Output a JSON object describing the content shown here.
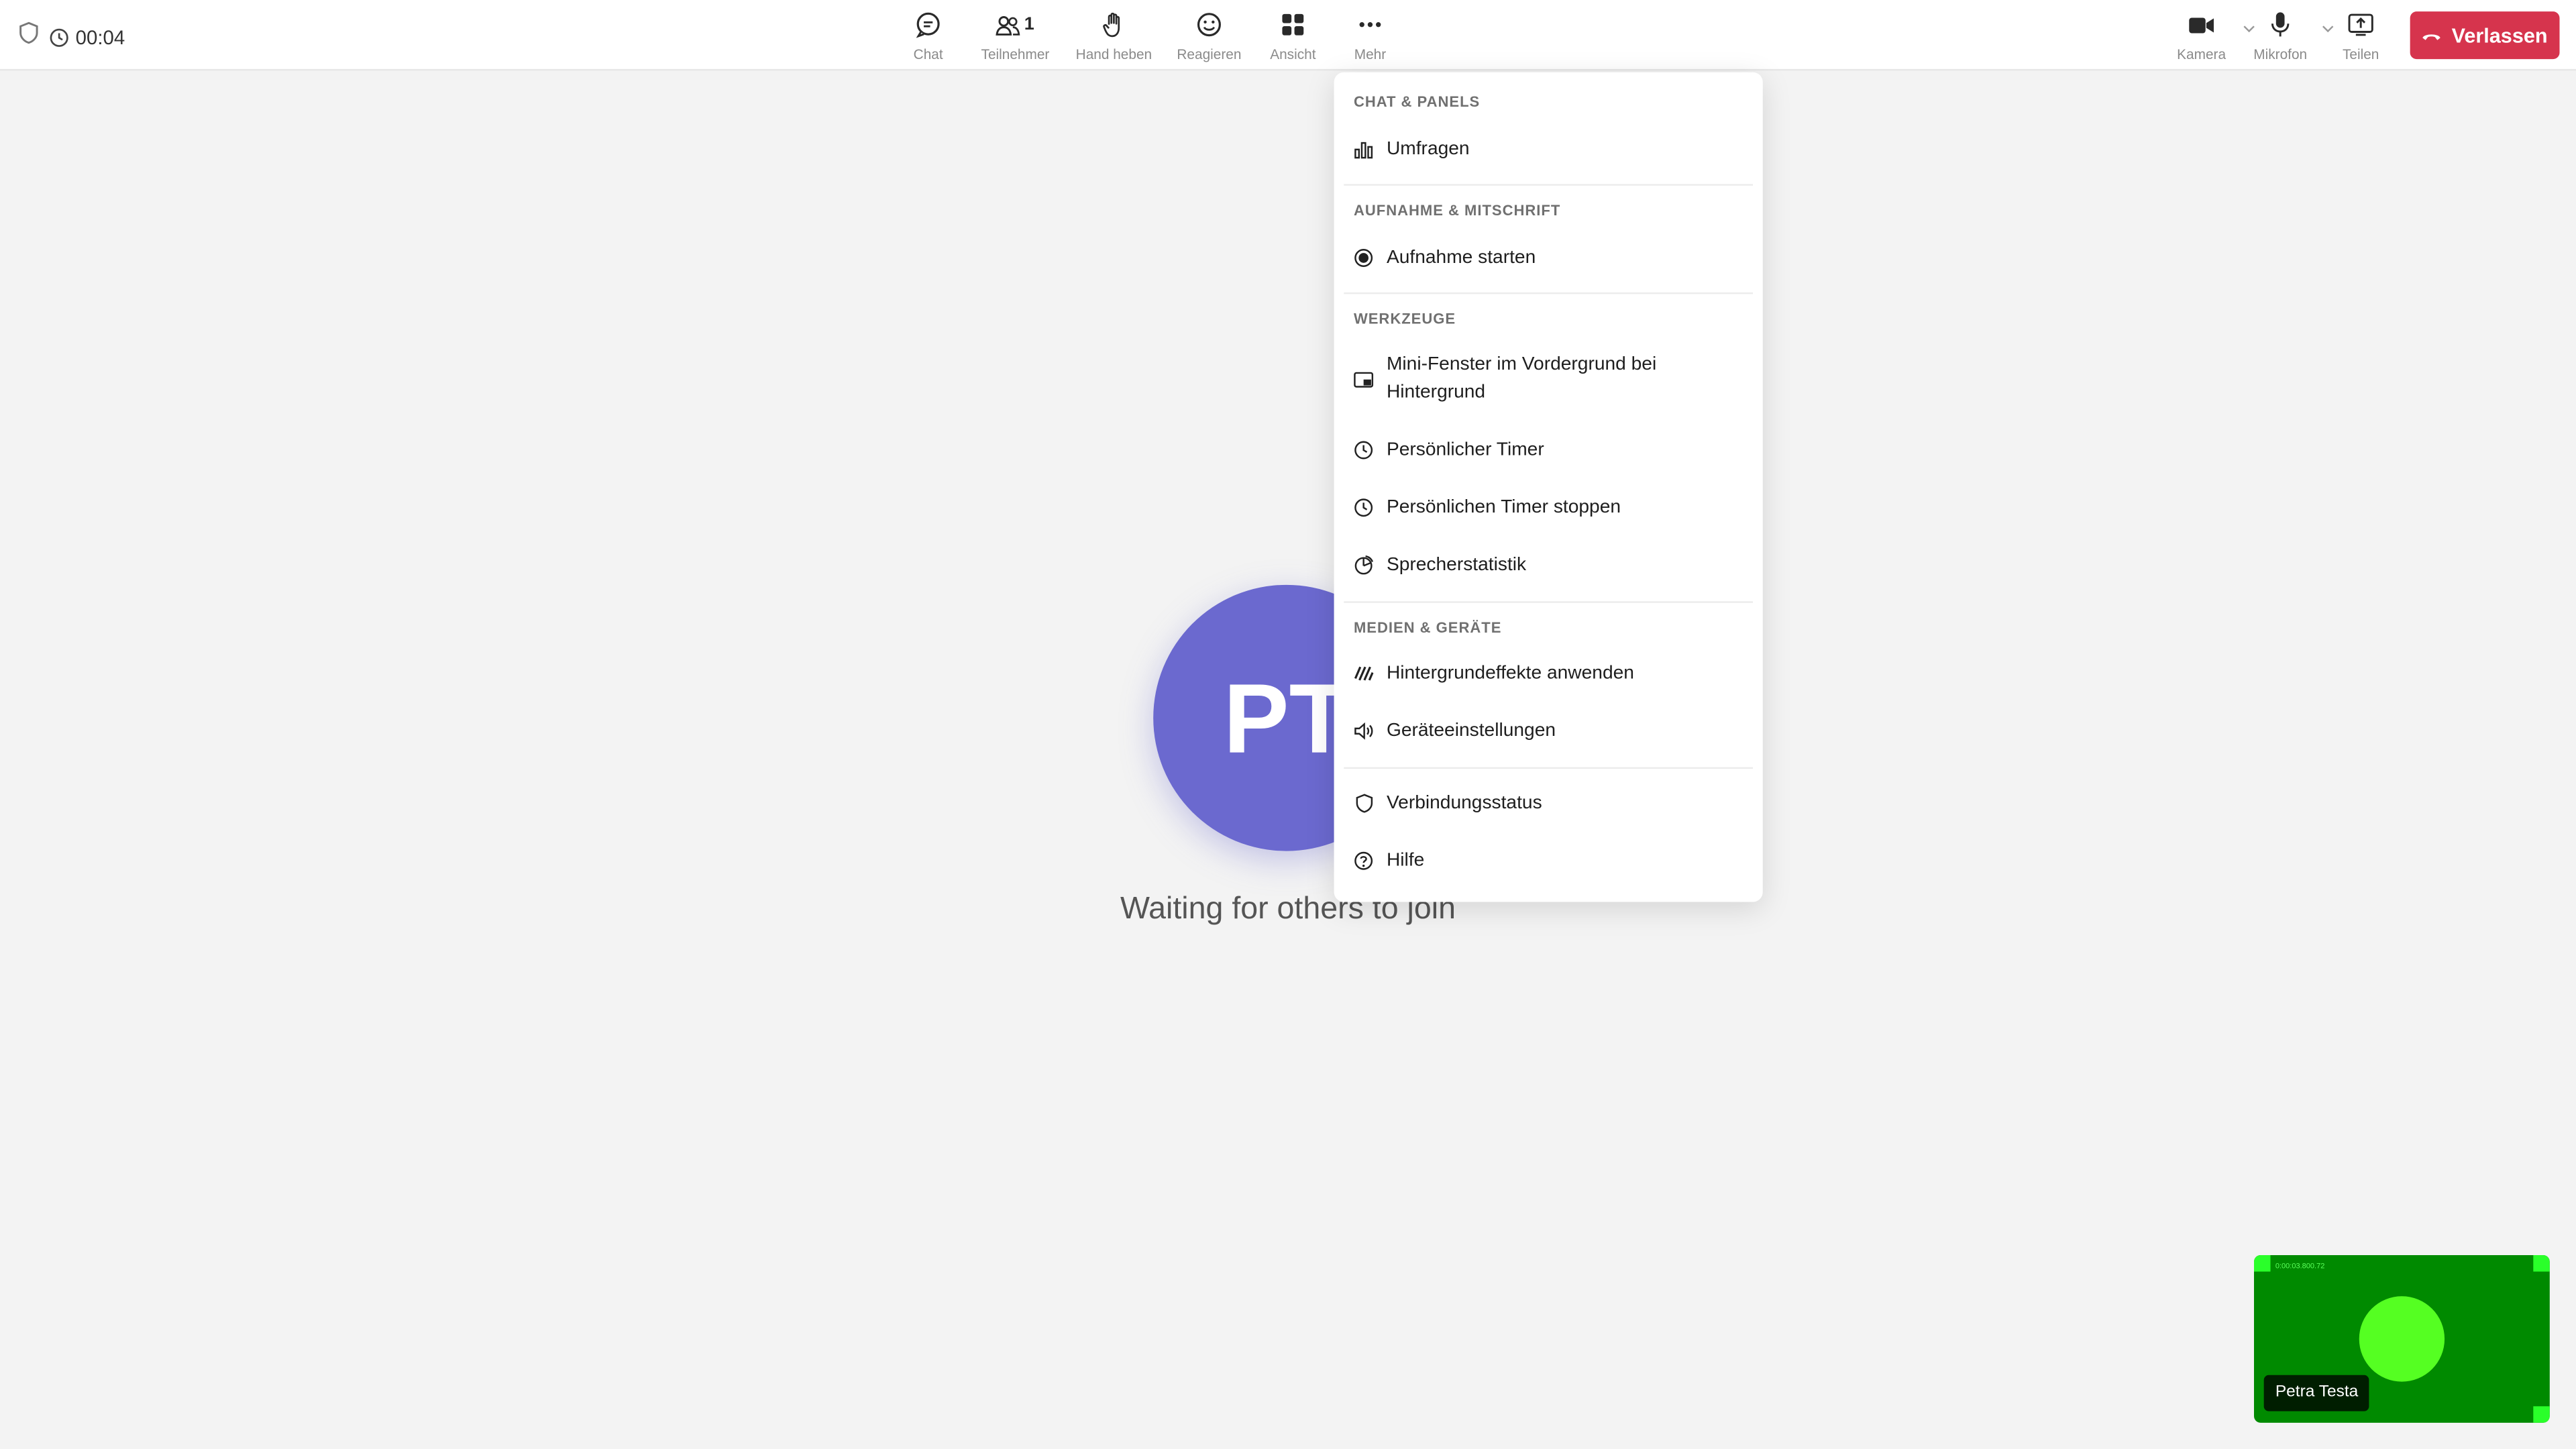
{
  "header": {
    "elapsed": "00:04",
    "participant_count": "1",
    "toolbar": [
      {
        "key": "chat",
        "label": "Chat"
      },
      {
        "key": "participants",
        "label": "Teilnehmer"
      },
      {
        "key": "raise_hand",
        "label": "Hand heben"
      },
      {
        "key": "react",
        "label": "Reagieren"
      },
      {
        "key": "view",
        "label": "Ansicht"
      },
      {
        "key": "more",
        "label": "Mehr"
      }
    ],
    "media": [
      {
        "key": "camera",
        "label": "Kamera"
      },
      {
        "key": "microphone",
        "label": "Mikrofon"
      },
      {
        "key": "share",
        "label": "Teilen"
      }
    ],
    "leave_label": "Verlassen",
    "leave_color": "#d6344d"
  },
  "stage": {
    "initials": "PT",
    "avatar_color": "#6b69cf",
    "waiting_text": "Waiting for others to join"
  },
  "menu": {
    "sections": [
      {
        "title": "CHAT & PANELS",
        "items": [
          {
            "label": "Umfragen",
            "icon": "chart-icon"
          }
        ]
      },
      {
        "title": "AUFNAHME & MITSCHRIFT",
        "items": [
          {
            "label": "Aufnahme starten",
            "icon": "record-icon"
          }
        ]
      },
      {
        "title": "WERKZEUGE",
        "items": [
          {
            "label": "Mini-Fenster im Vordergrund bei Hintergrund",
            "icon": "picture-in-picture-icon"
          },
          {
            "label": "Persönlicher Timer",
            "icon": "clock-icon"
          },
          {
            "label": "Persönlichen Timer stoppen",
            "icon": "clock-icon"
          },
          {
            "label": "Sprecherstatistik",
            "icon": "pie-chart-icon"
          }
        ]
      },
      {
        "title": "MEDIEN & GERÄTE",
        "items": [
          {
            "label": "Hintergrundeffekte anwenden",
            "icon": "background-effects-icon"
          },
          {
            "label": "Geräteeinstellungen",
            "icon": "speaker-icon"
          }
        ]
      },
      {
        "title": "",
        "items": [
          {
            "label": "Verbindungsstatus",
            "icon": "shield-icon"
          },
          {
            "label": "Hilfe",
            "icon": "help-icon"
          }
        ]
      }
    ]
  },
  "self_view": {
    "name": "Petra Testa",
    "timecode": "0:00:03.800.72",
    "background": "#008a00"
  }
}
